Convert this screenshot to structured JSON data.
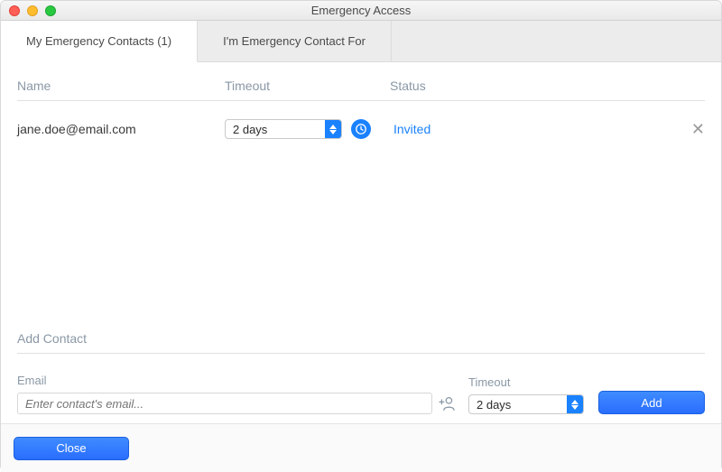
{
  "window": {
    "title": "Emergency Access"
  },
  "tabs": {
    "my_contacts": "My Emergency Contacts (1)",
    "contact_for": "I'm Emergency Contact For"
  },
  "columns": {
    "name": "Name",
    "timeout": "Timeout",
    "status": "Status"
  },
  "rows": [
    {
      "email": "jane.doe@email.com",
      "timeout": "2 days",
      "status": "Invited"
    }
  ],
  "add": {
    "section_title": "Add Contact",
    "email_label": "Email",
    "email_placeholder": "Enter contact's email...",
    "email_value": "",
    "timeout_label": "Timeout",
    "timeout_value": "2 days",
    "add_button": "Add"
  },
  "footer": {
    "close": "Close"
  },
  "icons": {
    "remove": "✕"
  }
}
